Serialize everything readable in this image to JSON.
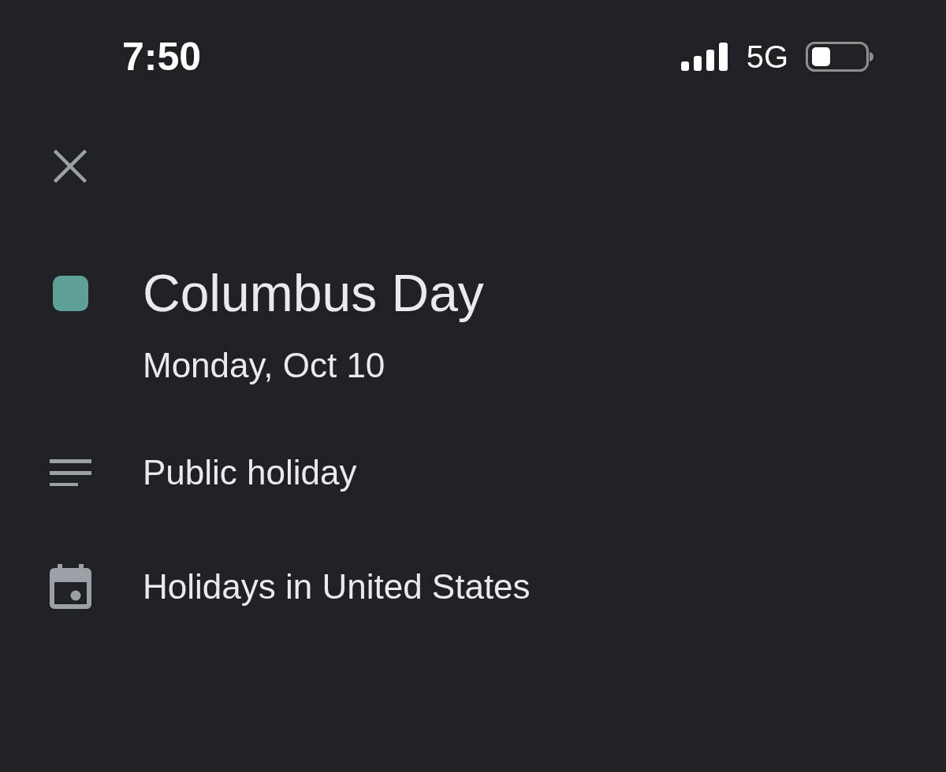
{
  "status_bar": {
    "time": "7:50",
    "network": "5G"
  },
  "event": {
    "title": "Columbus Day",
    "color": "#5e9f97",
    "date": "Monday, Oct 10"
  },
  "details": [
    {
      "kind": "description",
      "text": "Public holiday"
    },
    {
      "kind": "calendar",
      "text": "Holidays in United States"
    }
  ]
}
